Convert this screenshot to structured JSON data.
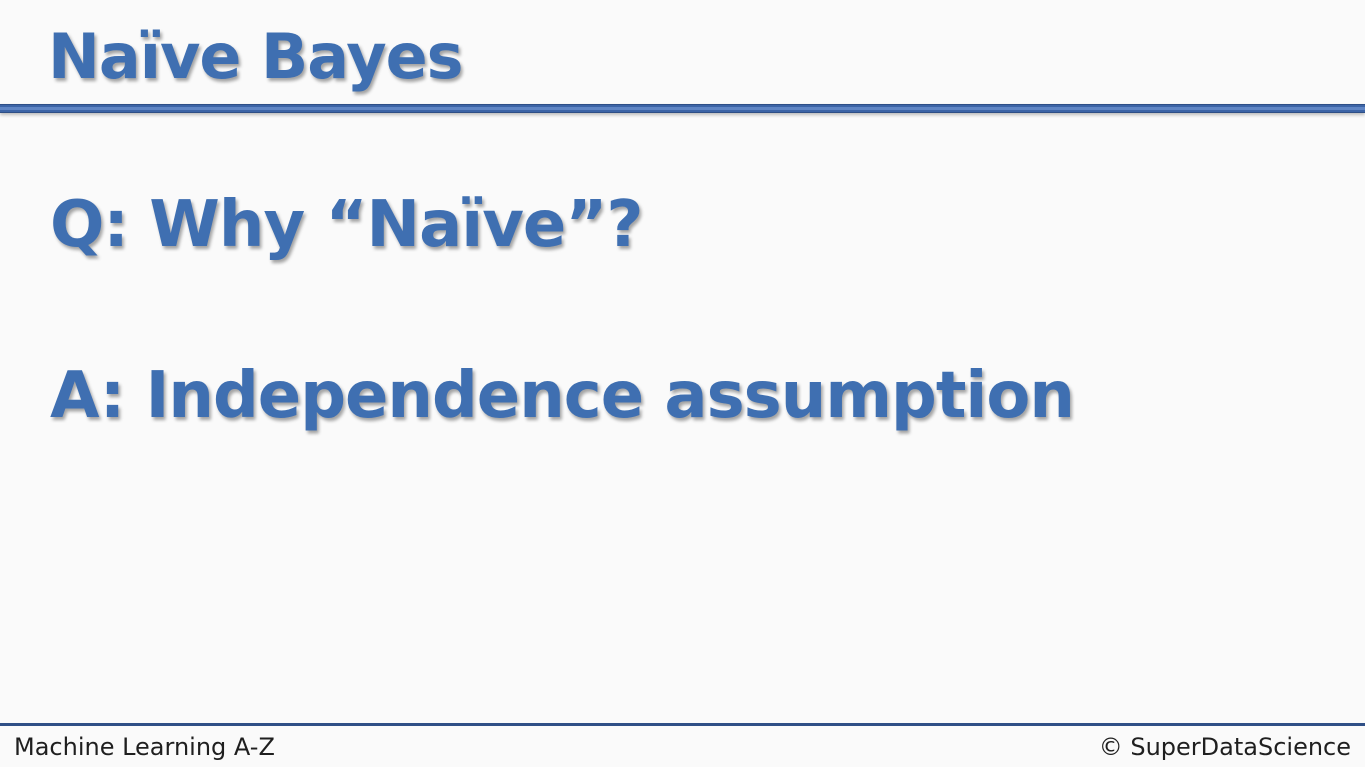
{
  "slide": {
    "title": "Naïve Bayes",
    "question": "Q: Why “Naïve”?",
    "answer": "A: Independence assumption"
  },
  "footer": {
    "course": "Machine Learning A-Z",
    "copyright": "© SuperDataScience"
  },
  "colors": {
    "heading_blue": "#3f6fb1",
    "rule_blue": "#3c64a6",
    "background": "#fafafa",
    "footer_text": "#1f1f1f"
  }
}
